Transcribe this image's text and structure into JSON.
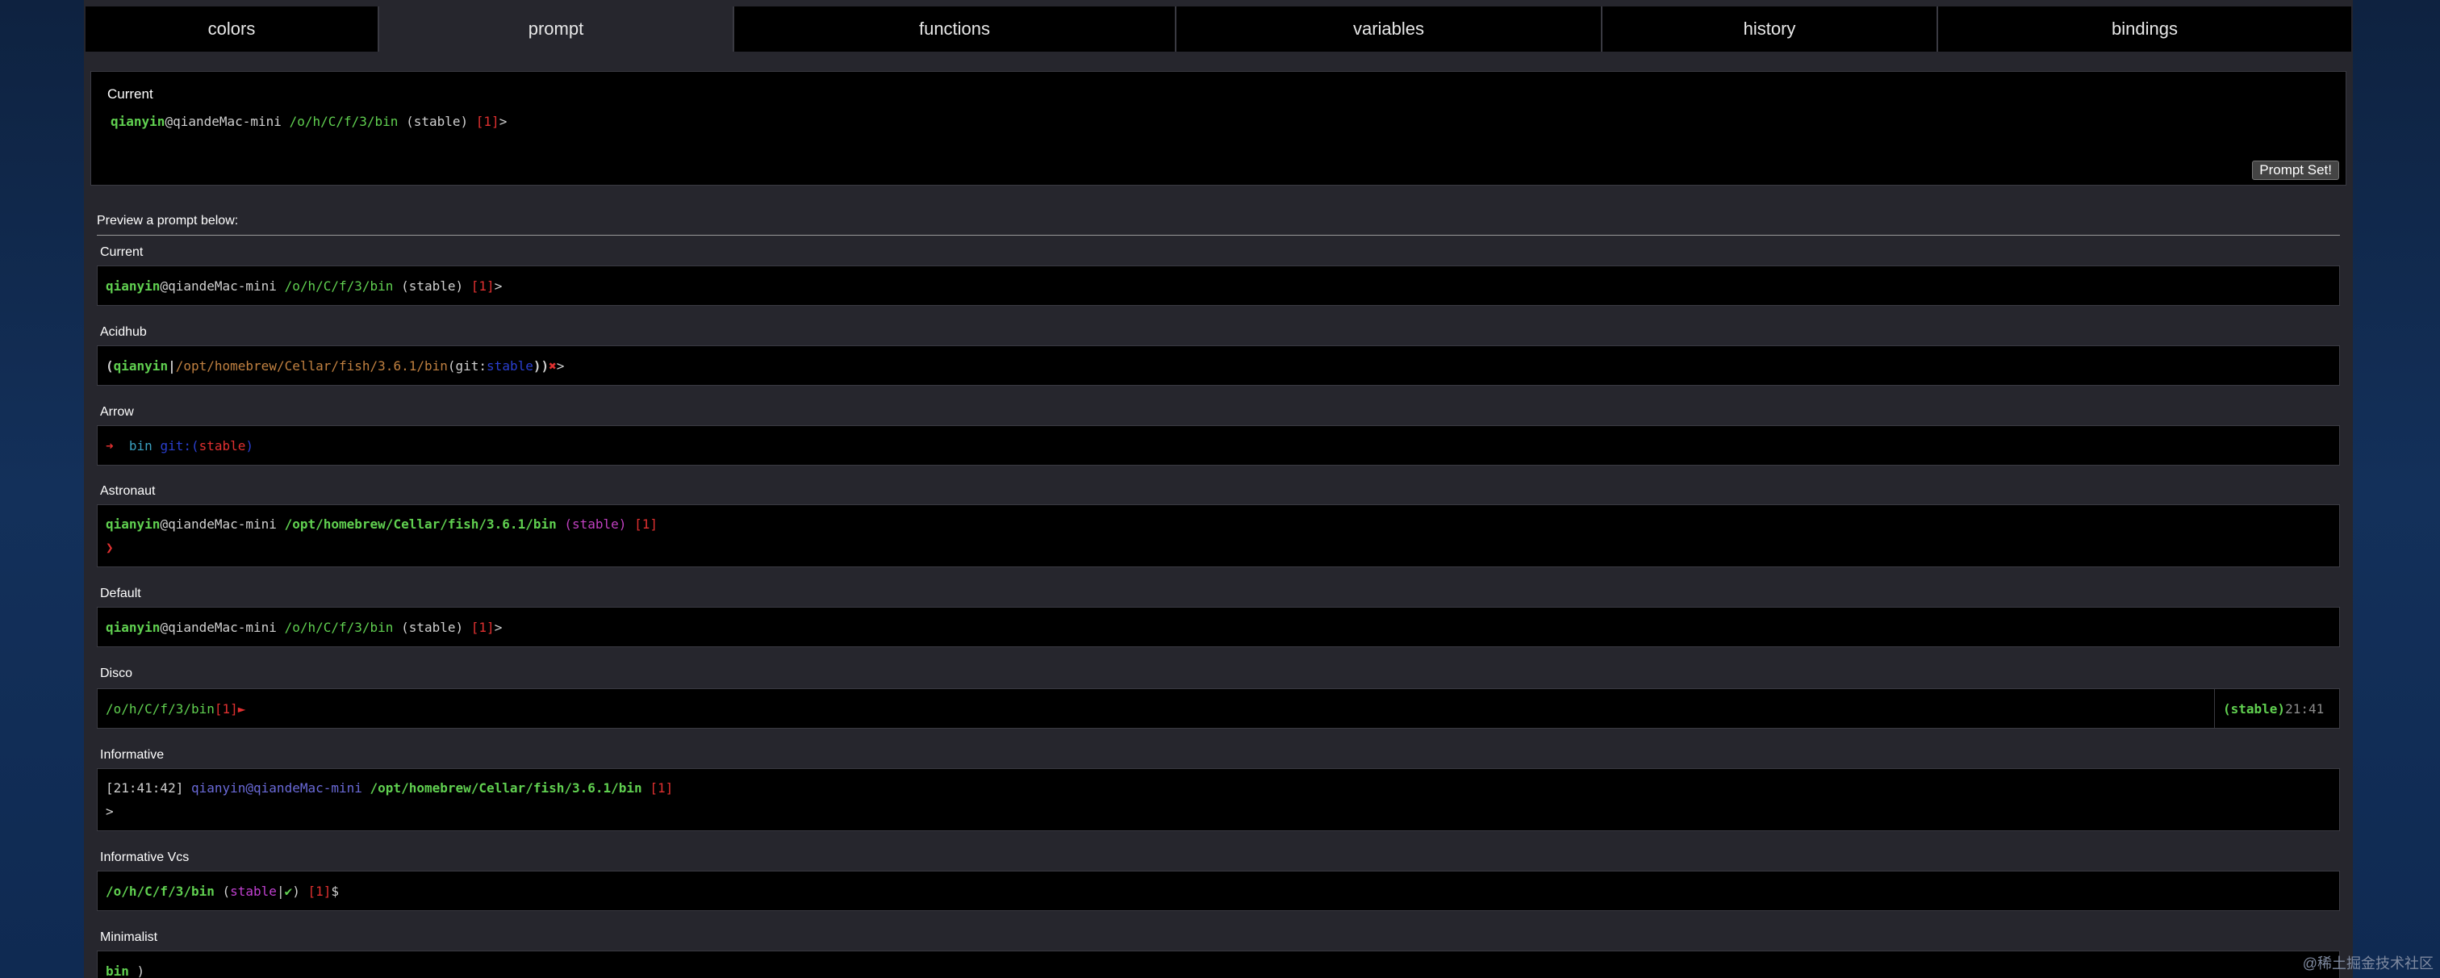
{
  "tabs": [
    "colors",
    "prompt",
    "functions",
    "variables",
    "history",
    "bindings"
  ],
  "current": {
    "title": "Current",
    "user": "qianyin",
    "host": "@qiandeMac-mini",
    "path": "/o/h/C/f/3/bin",
    "branch": "(stable)",
    "status": "[1]",
    "char": ">",
    "button": "Prompt Set!"
  },
  "preview": {
    "label": "Preview a prompt below:",
    "prompts": [
      {
        "name": "Current",
        "lines": [
          {
            "user": "qianyin",
            "host": "@qiandeMac-mini",
            "path": "/o/h/C/f/3/bin",
            "branch": "(stable)",
            "status": "[1]",
            "char": ">"
          }
        ]
      },
      {
        "name": "Acidhub",
        "lines": [
          {
            "open": "(",
            "user": "qianyin",
            "sep": "|",
            "path": "/opt/homebrew/Cellar/fish/3.6.1/bin",
            "git": "(git:",
            "branch": "stable",
            "close": "))",
            "mark": "✖",
            "char": ">"
          }
        ]
      },
      {
        "name": "Arrow",
        "lines": [
          {
            "arrow": "➜",
            "dir": "bin",
            "git": "git:(",
            "branch": "stable",
            "close": ")"
          }
        ]
      },
      {
        "name": "Astronaut",
        "lines": [
          {
            "user": "qianyin",
            "host": "@qiandeMac-mini",
            "path": "/opt/homebrew/Cellar/fish/3.6.1/bin",
            "branch": "(stable)",
            "status": "[1]"
          },
          {
            "char": "❯"
          }
        ]
      },
      {
        "name": "Default",
        "lines": [
          {
            "user": "qianyin",
            "host": "@qiandeMac-mini",
            "path": "/o/h/C/f/3/bin",
            "branch": "(stable)",
            "status": "[1]",
            "char": ">"
          }
        ]
      },
      {
        "name": "Disco",
        "lines": [
          {
            "path": "/o/h/C/f/3/bin",
            "status": "[1]",
            "char": "►"
          }
        ],
        "right": {
          "branch": "(stable)",
          "time": "21:41"
        }
      },
      {
        "name": "Informative",
        "lines": [
          {
            "time": "[21:41:42]",
            "user": "qianyin@qiandeMac-mini",
            "path": "/opt/homebrew/Cellar/fish/3.6.1/bin",
            "status": "[1]"
          },
          {
            "char": ">"
          }
        ]
      },
      {
        "name": "Informative Vcs",
        "lines": [
          {
            "path": "/o/h/C/f/3/bin",
            "open": "(",
            "branch": "stable",
            "sep": "|",
            "check": "✔",
            "close": ")",
            "status": "[1]",
            "char": "$"
          }
        ]
      },
      {
        "name": "Minimalist",
        "lines": [
          {
            "dir": "bin",
            "char": ")"
          }
        ]
      }
    ]
  },
  "watermark": "@稀土掘金技术社区",
  "colors": {
    "page_bg": "#26262d",
    "prompt_bg": "#000000",
    "user_green": "#60d050",
    "status_red": "#e03030",
    "git_blue": "#2a3fd0",
    "branch_magenta": "#c040d0"
  }
}
